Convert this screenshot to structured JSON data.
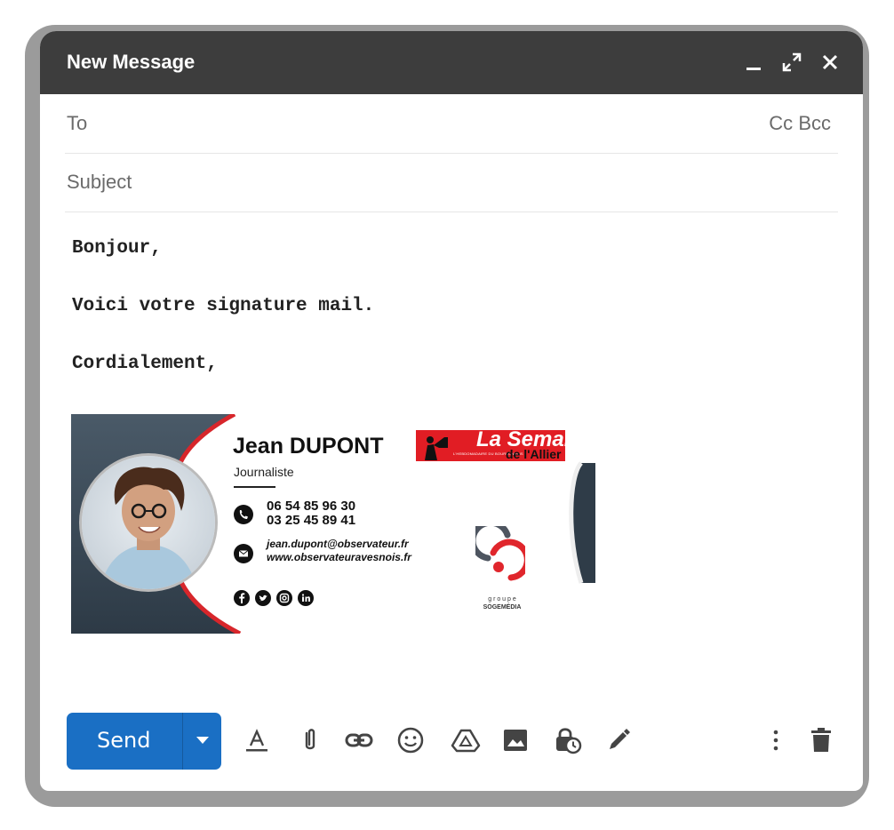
{
  "window": {
    "title": "New Message"
  },
  "header_controls": {
    "minimize": "minimize-icon",
    "expand": "expand-icon",
    "close": "close-icon"
  },
  "fields": {
    "to_label": "To",
    "cc_label": "Cc",
    "bcc_label": "Bcc",
    "subject_label": "Subject"
  },
  "body": {
    "lines": [
      "Bonjour,",
      "Voici votre signature mail.",
      "Cordialement,"
    ]
  },
  "signature": {
    "name": "Jean DUPONT",
    "role": "Journaliste",
    "phone_1": "06 54 85 96 30",
    "phone_2": "03 25 45 89 41",
    "email": "jean.dupont@observateur.fr",
    "website": "www.observateuravesnois.fr",
    "logo_top": "La Semaine",
    "logo_bottom": "de l'Allier",
    "logo_tagline": "L'HEBDOMADAIRE DU BOURBONNAIS",
    "group_label": "g r o u p e",
    "group_name": "SOGEMÉDIA",
    "social_icons": [
      "facebook-icon",
      "twitter-icon",
      "instagram-icon",
      "linkedin-icon"
    ]
  },
  "toolbar": {
    "send_label": "Send",
    "icons": [
      "text-format-icon",
      "attach-icon",
      "link-icon",
      "emoji-icon",
      "drive-icon",
      "image-icon",
      "confidential-icon",
      "signature-pen-icon",
      "more-options-icon",
      "trash-icon"
    ]
  },
  "colors": {
    "title_bar": "#3d3d3d",
    "send_button": "#1a6fc4",
    "accent_red": "#d7262b"
  }
}
